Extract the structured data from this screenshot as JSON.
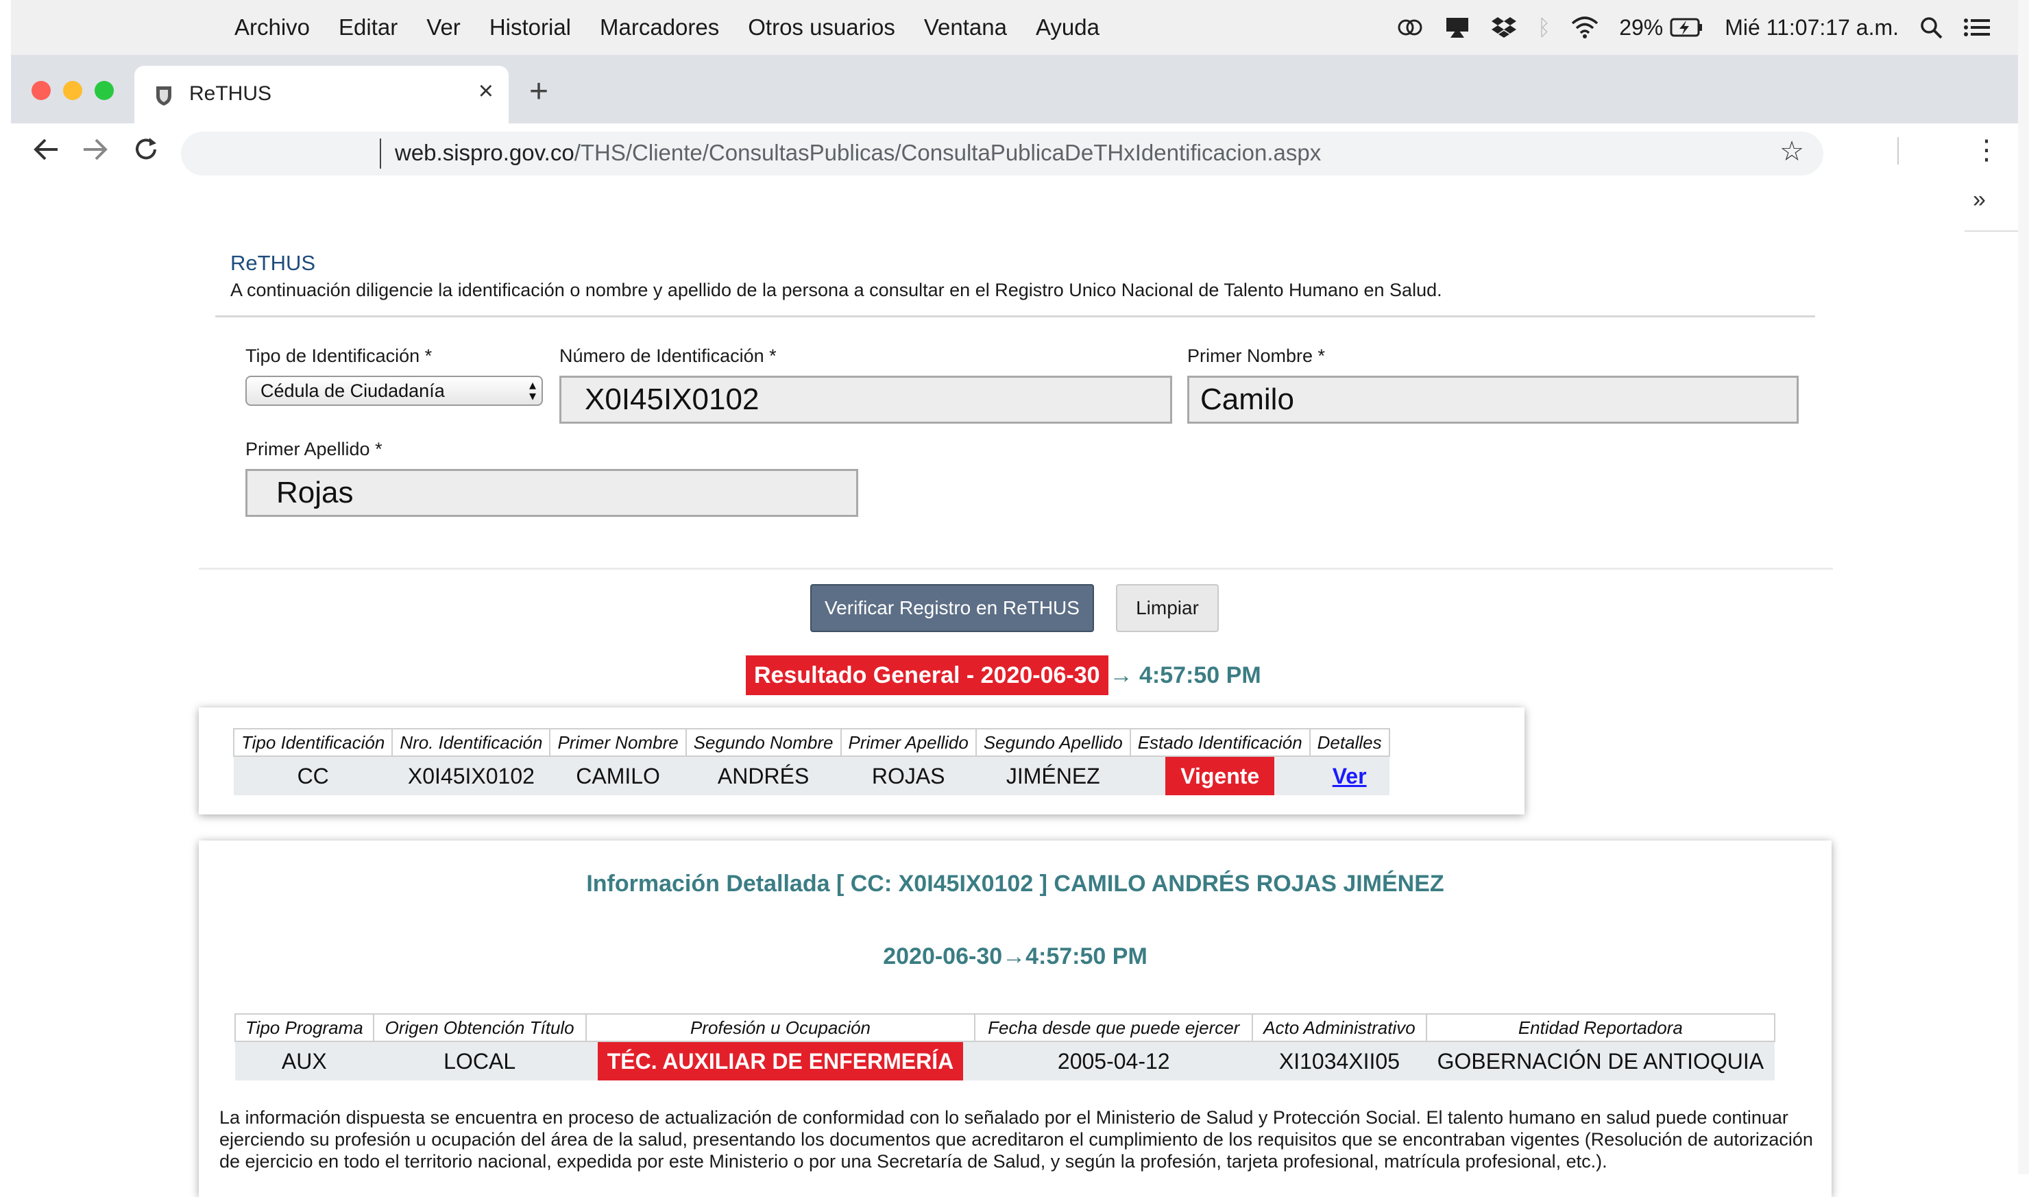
{
  "menubar": {
    "items": [
      "Archivo",
      "Editar",
      "Ver",
      "Historial",
      "Marcadores",
      "Otros usuarios",
      "Ventana",
      "Ayuda"
    ],
    "battery": "29%",
    "clock": "Mié 11:07:17 a.m."
  },
  "browser": {
    "tab_title": "ReTHUS",
    "tab_close": "×",
    "new_tab": "+",
    "url_host": "web.sispro.gov.co",
    "url_path": "/THS/Cliente/ConsultasPublicas/ConsultaPublicaDeTHxIdentificacion.aspx",
    "star": "☆",
    "menu": "⋮",
    "chevrons": "»"
  },
  "page": {
    "heading": "ReTHUS",
    "intro": "A continuación diligencie la identificación o nombre y apellido de la persona a consultar en el Registro Unico Nacional de Talento Humano en Salud."
  },
  "form": {
    "tipo_label": "Tipo de Identificación *",
    "tipo_value": "Cédula de Ciudadanía",
    "numero_label": "Número de Identificación *",
    "numero_value": "X0I45IX0102",
    "nombre_label": "Primer Nombre *",
    "nombre_value": "Camilo",
    "apellido_label": "Primer Apellido *",
    "apellido_value": "Rojas",
    "verify_label": "Verificar Registro en ReTHUS",
    "clear_label": "Limpiar"
  },
  "result": {
    "badge": "Resultado General - 2020-06-30",
    "time": "→ 4:57:50 PM",
    "headers": [
      "Tipo Identificación",
      "Nro. Identificación",
      "Primer Nombre",
      "Segundo Nombre",
      "Primer Apellido",
      "Segundo Apellido",
      "Estado Identificación",
      "Detalles"
    ],
    "row": {
      "tipo": "CC",
      "nro": "X0I45IX0102",
      "primer_nombre": "CAMILO",
      "segundo_nombre": "ANDRÉS",
      "primer_apellido": "ROJAS",
      "segundo_apellido": "JIMÉNEZ",
      "estado": "Vigente",
      "detalles": "Ver"
    }
  },
  "detail": {
    "title": "Información Detallada [ CC: X0I45IX0102 ] CAMILO ANDRÉS ROJAS JIMÉNEZ",
    "timestamp": "2020-06-30→4:57:50 PM",
    "headers": [
      "Tipo Programa",
      "Origen Obtención Título",
      "Profesión u Ocupación",
      "Fecha desde que puede ejercer",
      "Acto Administrativo",
      "Entidad Reportadora"
    ],
    "row": {
      "tipo_programa": "AUX",
      "origen": "LOCAL",
      "profesion": "TÉC. AUXILIAR DE ENFERMERÍA",
      "fecha": "2005-04-12",
      "acto": "XI1034XII05",
      "entidad": "GOBERNACIÓN DE ANTIOQUIA"
    },
    "disclaimer": "La información dispuesta se encuentra en proceso de actualización de conformidad con lo señalado por el Ministerio de Salud y Protección Social. El talento humano en salud puede continuar ejerciendo su profesión u ocupación del área de la salud, presentando los documentos que acreditaron el cumplimiento de los requisitos que se encontraban vigentes (Resolución de autorización de ejercicio en todo el territorio nacional, expedida por este Ministerio o por una Secretaría de Salud, y según la profesión, tarjeta profesional, matrícula profesional, etc.)."
  },
  "colors": {
    "accent_red": "#e3202a",
    "teal_text": "#3b7d84",
    "heading_blue": "#1e4c7c",
    "button_blue": "#5d6f86"
  }
}
